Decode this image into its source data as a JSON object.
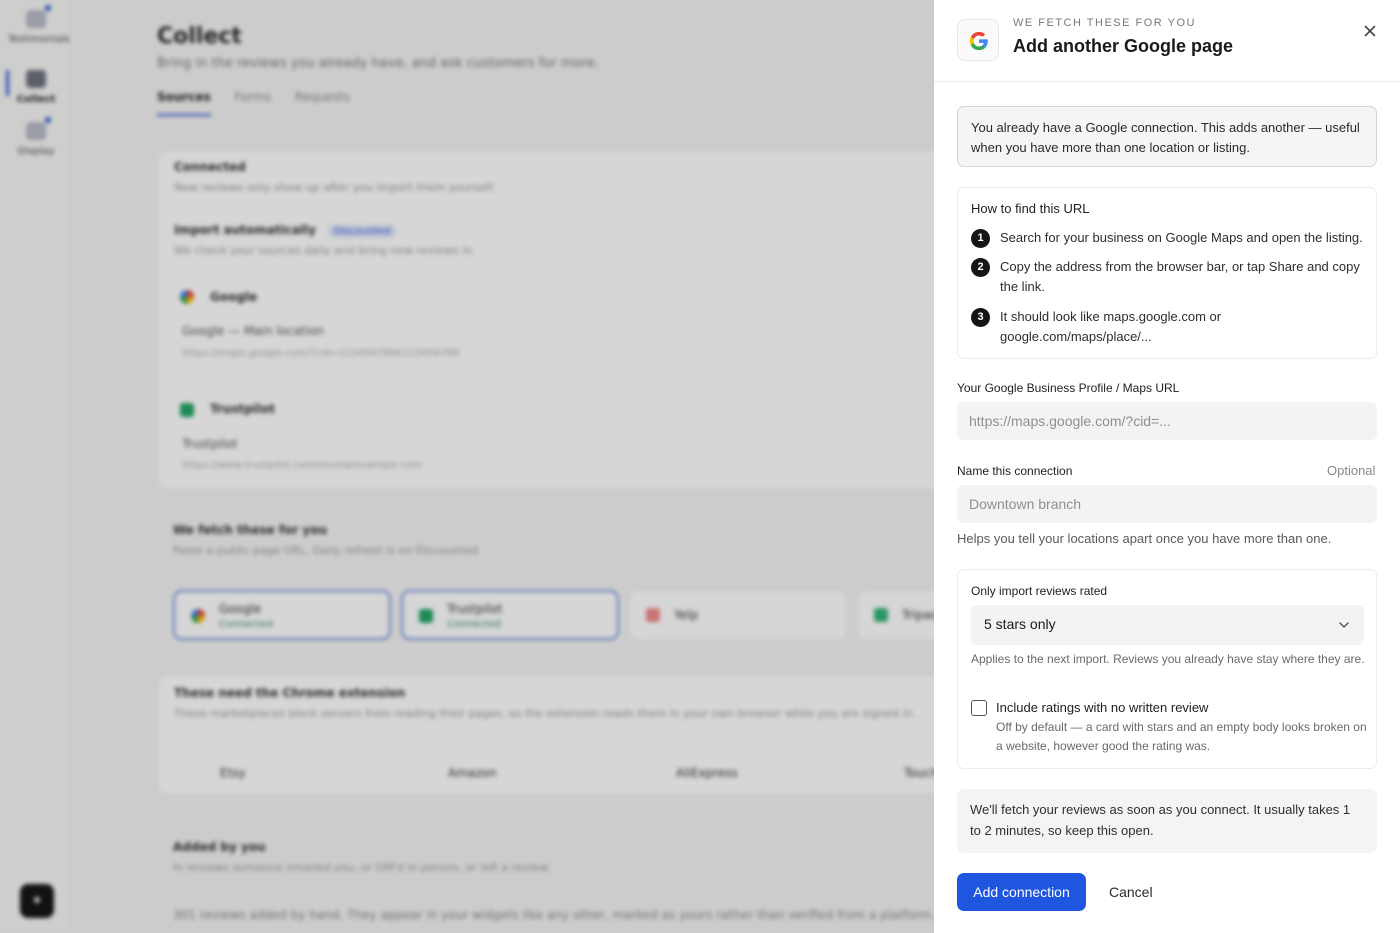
{
  "colors": {
    "accent": "#1f56e0",
    "panel_bg": "#ffffff",
    "muted_box": "#f4f4f3",
    "step_badge": "#151515"
  },
  "background": {
    "sidebar": [
      {
        "label": "Testimonials",
        "icon": "testimonials-icon"
      },
      {
        "label": "Collect",
        "icon": "collect-icon"
      },
      {
        "label": "Display",
        "icon": "display-icon"
      }
    ],
    "title": "Collect",
    "subtitle": "Bring in the reviews you already have, and ask customers for more.",
    "tabs": [
      "Sources",
      "Forms",
      "Requests"
    ],
    "connected_heading": "Connected",
    "connected_sub": "New reviews only show up after you import them yourself.",
    "import_heading": "Import automatically",
    "import_badge": "Discounted",
    "import_sub": "We check your sources daily and bring new reviews in.",
    "sources": [
      {
        "name": "Google",
        "item": "Google — Main location",
        "url": "https://maps.google.com/?cid=1234567890123456789"
      },
      {
        "name": "Trustpilot",
        "item": "Trustpilot",
        "url": "https://www.trustpilot.com/review/example.com"
      }
    ],
    "fetch_heading": "We fetch these for you",
    "fetch_sub": "Paste a public page URL. Daily refresh is on Discounted.",
    "fetch_tiles": [
      {
        "name": "Google",
        "status": "Connected"
      },
      {
        "name": "Trustpilot",
        "status": "Connected"
      },
      {
        "name": "Yelp",
        "status": ""
      },
      {
        "name": "Tripadvisor",
        "status": ""
      }
    ],
    "ext_heading": "These need the Chrome extension",
    "ext_sub": "These marketplaces block servers from reading their pages, so the extension reads them in your own browser while you are signed in.",
    "ext_tiles": [
      "Etsy",
      "Amazon",
      "AliExpress",
      "Touch"
    ],
    "added_heading": "Added by you",
    "added_sub": "In reviews someone emailed you, or DM'd in person, or left a review.",
    "added_body": "301 reviews added by hand. They appear in your widgets like any other, marked as yours rather than verified from a platform."
  },
  "panel": {
    "eyebrow": "WE FETCH THESE FOR YOU",
    "title": "Add another Google page",
    "info": "You already have a Google connection. This adds another — useful when you have more than one location or listing.",
    "howto": {
      "title": "How to find this URL",
      "steps": [
        {
          "num": "1",
          "text": "Search for your business on Google Maps and open the listing."
        },
        {
          "num": "2",
          "text": "Copy the address from the browser bar, or tap Share and copy the link."
        },
        {
          "num": "3",
          "text": "It should look like maps.google.com or google.com/maps/place/..."
        }
      ]
    },
    "url_field": {
      "label": "Your Google Business Profile / Maps URL",
      "placeholder": "https://maps.google.com/?cid=...",
      "value": ""
    },
    "name_field": {
      "label": "Name this connection",
      "optional": "Optional",
      "placeholder": "Downtown branch",
      "value": "",
      "help": "Helps you tell your locations apart once you have more than one."
    },
    "rating": {
      "label": "Only import reviews rated",
      "selected": "5 stars only",
      "note": "Applies to the next import. Reviews you already have stay where they are.",
      "checkbox_label": "Include ratings with no written review",
      "checkbox_checked": false,
      "checkbox_note": "Off by default — a card with stars and an empty body looks broken on a website, however good the rating was."
    },
    "fetch_note": "We'll fetch your reviews as soon as you connect. It usually takes 1 to 2 minutes, so keep this open.",
    "primary_label": "Add connection",
    "cancel_label": "Cancel"
  }
}
